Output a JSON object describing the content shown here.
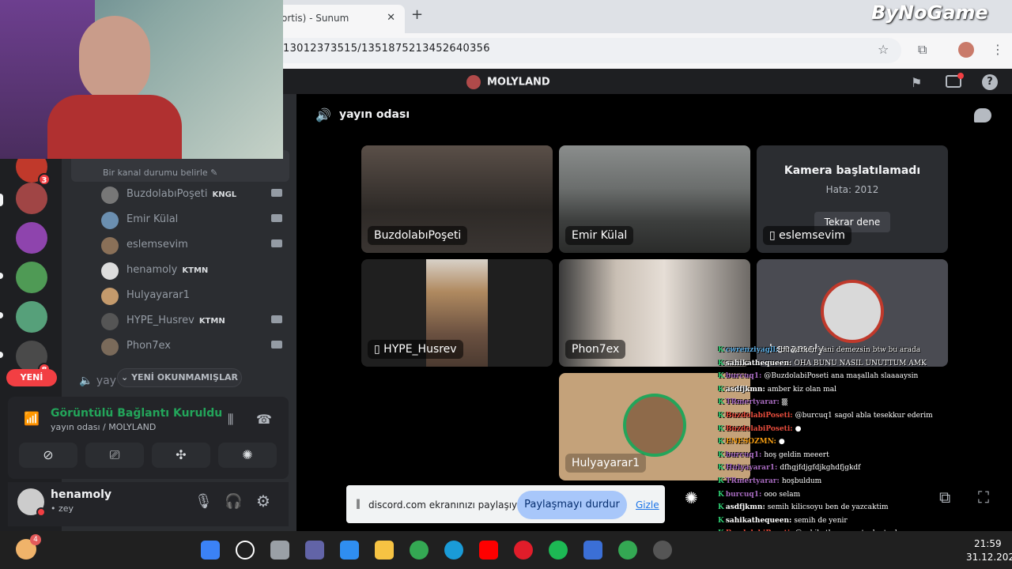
{
  "browser": {
    "tab_title": "ortis) - Sunum",
    "url": "13012373515/1351875213452640356"
  },
  "brand": {
    "logo_text": "ByNoGame"
  },
  "discord": {
    "server_name": "MOLYLAND",
    "guild_badges": [
      "3",
      "8"
    ],
    "new_label": "YENİ",
    "channel_status_placeholder": "Bir kanal durumu belirle",
    "members": [
      {
        "name": "BuzdolabıPoşeti",
        "tag": "KNGL"
      },
      {
        "name": "Emir Külal",
        "tag": ""
      },
      {
        "name": "eslemsevim",
        "tag": ""
      },
      {
        "name": "henamoly",
        "tag": "KTMN"
      },
      {
        "name": "Hulyayarar1",
        "tag": ""
      },
      {
        "name": "HYPE_Husrev",
        "tag": "KTMN"
      },
      {
        "name": "Phon7ex",
        "tag": ""
      }
    ],
    "unread_pill": "YENİ OKUNMAMIŞLAR",
    "second_channel_prefix": "yay",
    "connection": {
      "title": "Görüntülü Bağlantı Kuruldu",
      "subtitle": "yayın odası / MOLYLAND"
    },
    "user": {
      "name": "henamoly",
      "status": "• zey"
    },
    "voice_channel_title": "yayın odası",
    "tiles": [
      {
        "name": "BuzdolabıPoşeti"
      },
      {
        "name": "Emir Külal"
      },
      {
        "name": "eslemsevim",
        "error_title": "Kamera başlatılamadı",
        "error_code": "Hata: 2012",
        "retry": "Tekrar dene"
      },
      {
        "name": "HYPE_Husrev"
      },
      {
        "name": "Phon7ex"
      },
      {
        "name": "henamoly"
      },
      {
        "name": "Hulyayarar1"
      }
    ],
    "screen_share": {
      "text": "discord.com ekranınızı paylaşıyor.",
      "stop": "Paylaşmayı durdur",
      "hide": "Gizle"
    }
  },
  "chat": [
    {
      "user": "cwrenziyagil:",
      "msg": "bu varken yani demezsin btw bu arada",
      "color": "#5dade2"
    },
    {
      "user": "sahikathequeen:",
      "msg": "OHA BUNU NASIL UNUTTUM AMK",
      "color": "#ffffff"
    },
    {
      "user": "burcuq1:",
      "msg": "@BuzdolabiPoseti ana maşallah slaaaaysin",
      "color": "#a569bd"
    },
    {
      "user": "asdfjkmn:",
      "msg": "amber kiz olan mal",
      "color": "#ffffff"
    },
    {
      "user": "TRmertyarar:",
      "msg": "▒",
      "color": "#a569bd"
    },
    {
      "user": "BuzdolabiPoseti:",
      "msg": "@burcuq1 sagol abla tesekkur ederim",
      "color": "#e74c3c"
    },
    {
      "user": "BuzdolabiPoseti:",
      "msg": "●",
      "color": "#e74c3c"
    },
    {
      "user": "ENESOZMN:",
      "msg": "●",
      "color": "#f39c12"
    },
    {
      "user": "burcuq1:",
      "msg": "hoş geldin meeert",
      "color": "#a569bd"
    },
    {
      "user": "Hulyayarar1:",
      "msg": "dfhgjfdjgfdjkghdfjgkdf",
      "color": "#a569bd"
    },
    {
      "user": "TRmertyarar:",
      "msg": "hoşbuldum",
      "color": "#a569bd"
    },
    {
      "user": "burcuq1:",
      "msg": "ooo selam",
      "color": "#a569bd"
    },
    {
      "user": "asdfjkmn:",
      "msg": "semih kilicsoyu ben de yazcaktim",
      "color": "#ffffff"
    },
    {
      "user": "sahikathequeen:",
      "msg": "semih de yenir",
      "color": "#ffffff"
    },
    {
      "user": "BuzdolabiPoseti:",
      "msg": "@sahikathequeen tovbe tovbe",
      "color": "#e74c3c"
    },
    {
      "user": "sahikathequeen:",
      "msg": "ben komik erkek seviyorum abla",
      "color": "#ffffff"
    },
    {
      "user": "burcuq1:",
      "msg": "ay hayıl eslo",
      "color": "#a569bd"
    }
  ],
  "taskbar": {
    "weather_badge": "4",
    "time": "21:59",
    "date": "31.12.2025"
  }
}
